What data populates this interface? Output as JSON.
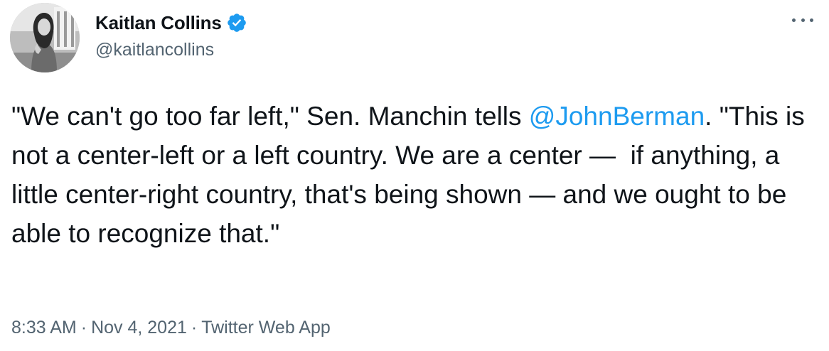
{
  "author": {
    "display_name": "Kaitlan Collins",
    "handle": "@kaitlancollins",
    "verified": true,
    "avatar_icon": "profile-photo"
  },
  "more_icon": "ellipsis-icon",
  "tweet": {
    "text_part1": "\"We can't go too far left,\" Sen. Manchin tells ",
    "mention": "@JohnBerman",
    "text_part2": ". \"This is not a center-left or a left country. We are a center —  if anything, a little center-right country, that's being shown — and we ought to be able to recognize that.\""
  },
  "meta": {
    "time": "8:33 AM",
    "separator": "·",
    "date": "Nov 4, 2021",
    "source": "Twitter Web App"
  },
  "colors": {
    "link": "#1d9bf0",
    "text": "#0f1419",
    "secondary": "#536471",
    "verified_badge": "#1d9bf0"
  }
}
